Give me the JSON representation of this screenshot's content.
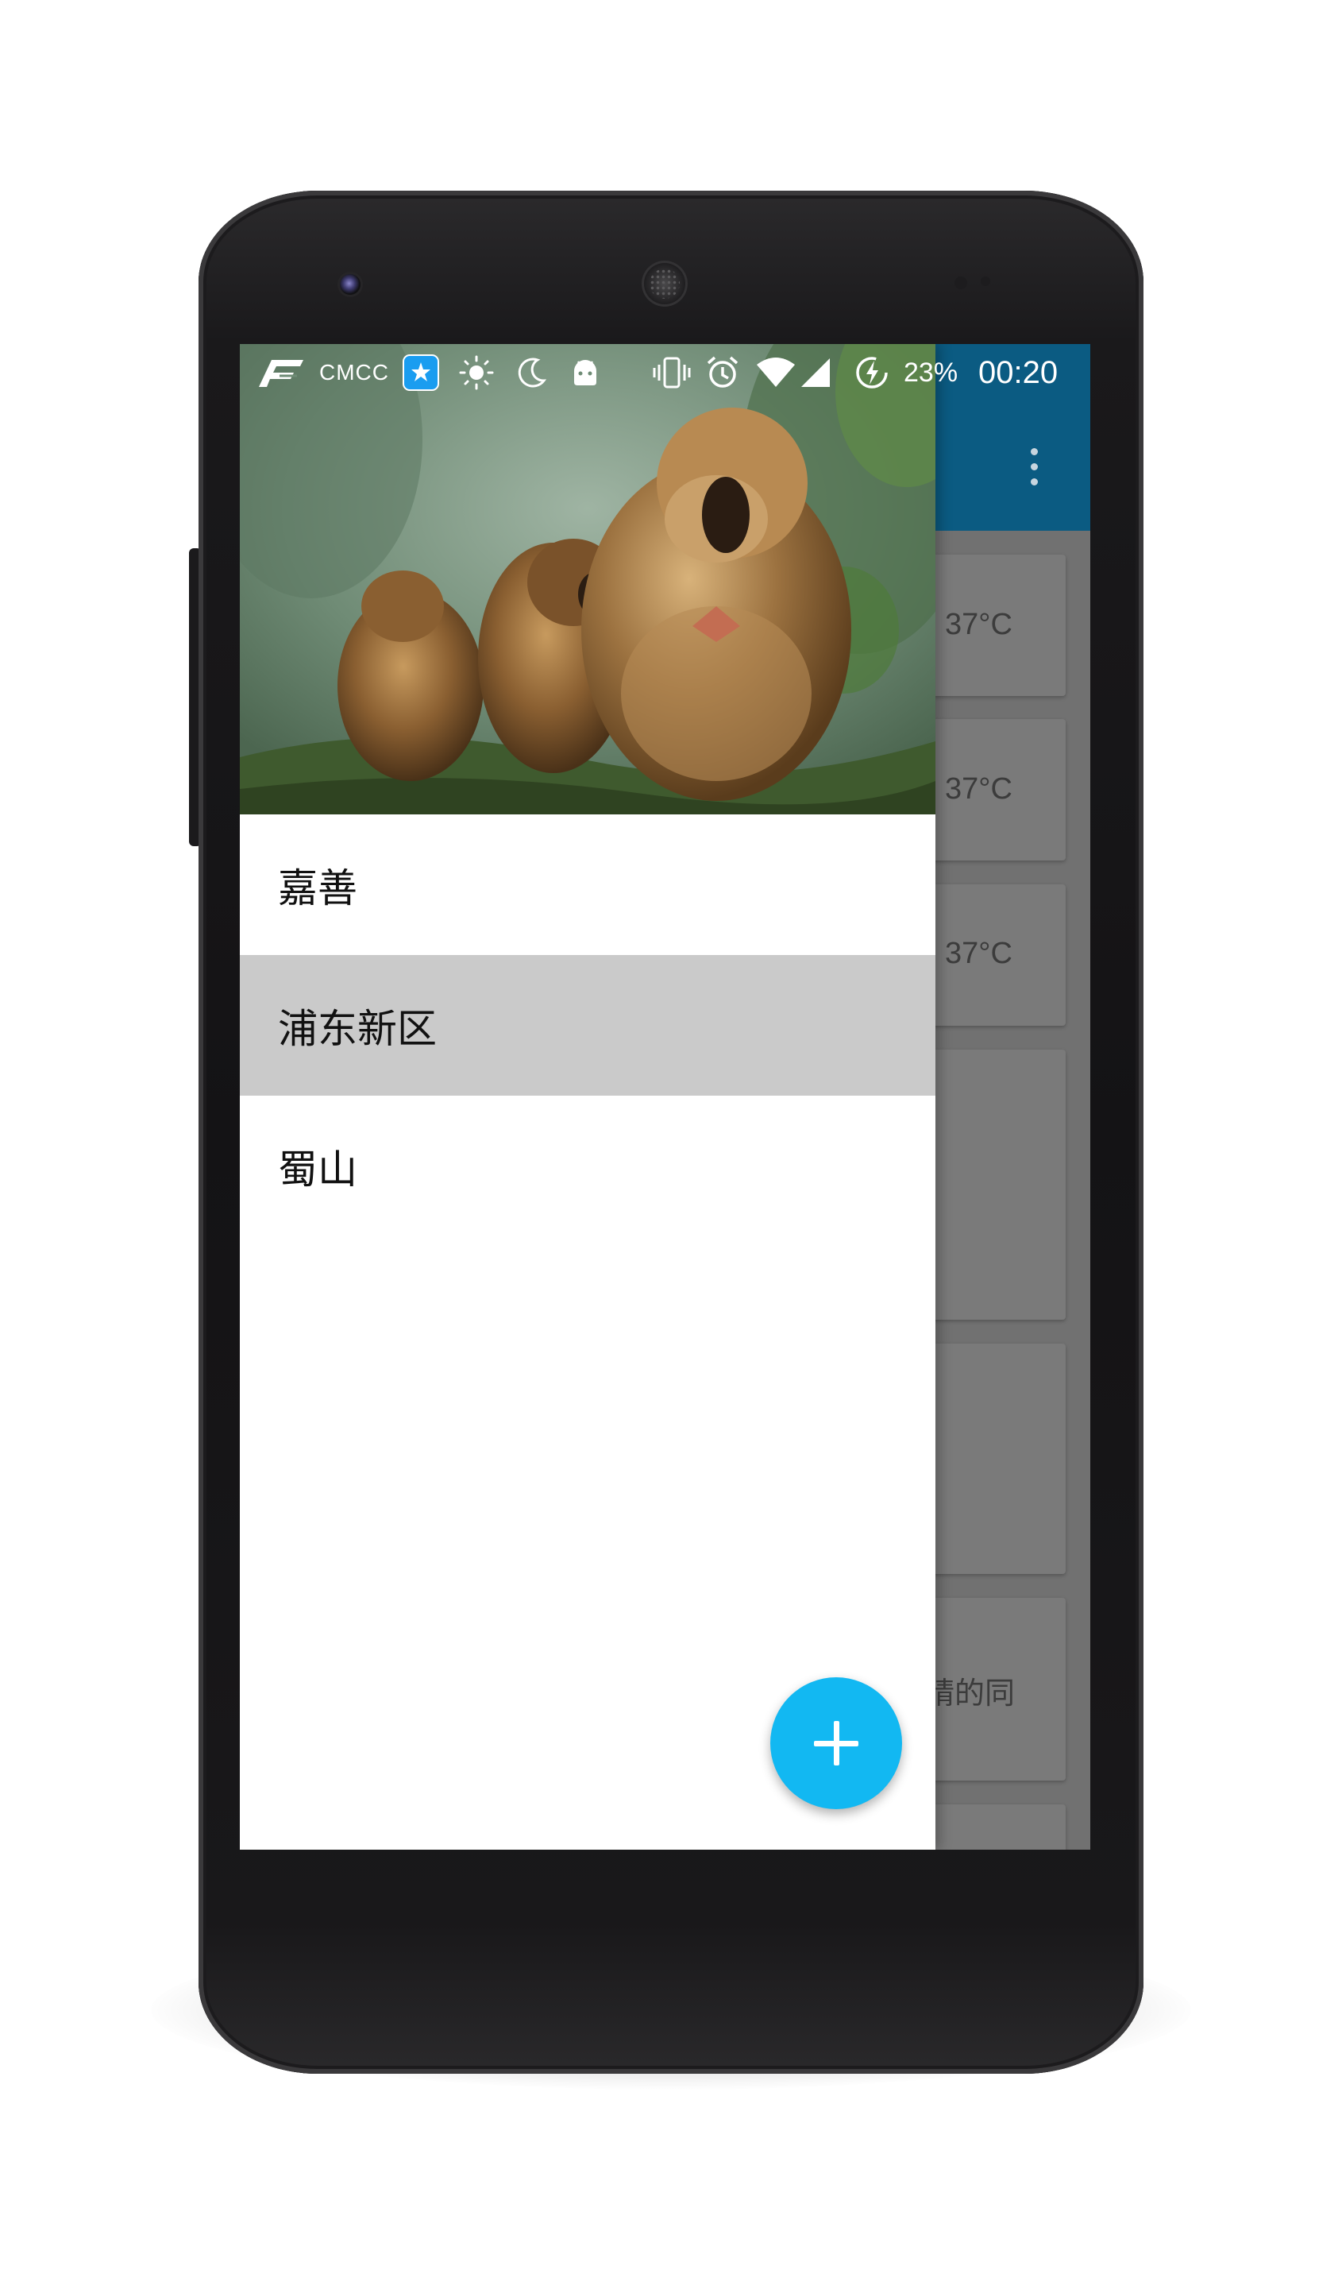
{
  "status_bar": {
    "carrier": "CMCC",
    "battery_percent": "23%",
    "time": "00:20",
    "icons": [
      "carrier-logo-icon",
      "qq-notification-icon",
      "brightness-icon",
      "night-mode-icon",
      "android-icon",
      "vibrate-icon",
      "alarm-icon",
      "wifi-icon",
      "cell-signal-icon",
      "battery-charging-icon"
    ]
  },
  "toolbar": {
    "overflow_icon": "more-vert-icon"
  },
  "background_cards": [
    {
      "text": "37°C"
    },
    {
      "text": "37°C"
    },
    {
      "text": "37°C"
    },
    {
      "text": ""
    },
    {
      "text": ""
    },
    {
      "text": "晴的同"
    }
  ],
  "drawer": {
    "header_image": "gelada-monkeys-photo",
    "items": [
      {
        "label": "嘉善",
        "selected": false
      },
      {
        "label": "浦东新区",
        "selected": true
      },
      {
        "label": "蜀山",
        "selected": false
      }
    ]
  },
  "fab": {
    "icon": "add-icon"
  },
  "colors": {
    "toolbar": "#0b5b82",
    "fab": "#12b8f2",
    "selected_item": "#cacaca",
    "scrim": "#717171"
  }
}
